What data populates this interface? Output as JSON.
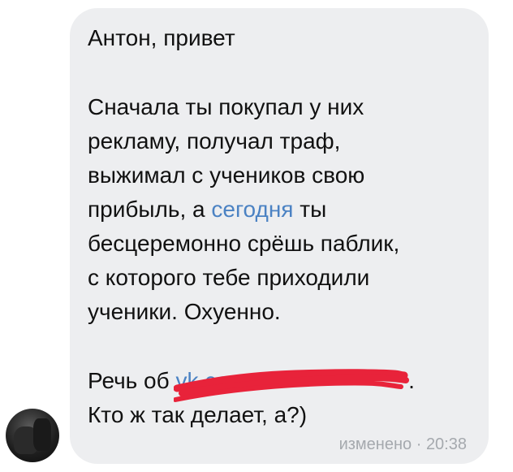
{
  "message": {
    "greeting": "Антон, привет",
    "para1": {
      "line1": "Сначала ты покупал у них",
      "line2": "рекламу, получал траф,",
      "line3": "выжимал с учеников свою",
      "line4_start": "прибыль, а ",
      "line4_link": "сегодня",
      "line4_end": " ты",
      "line5": "бесцеремонно срёшь паблик,",
      "line6": "с которого тебе приходили",
      "line7": "ученики. Охуенно."
    },
    "para2": {
      "line1_start": "Речь об ",
      "line1_link": "vk.com",
      "line1_end": ".",
      "line2": "Кто ж так делает, а?)"
    }
  },
  "meta": {
    "edited_label": "изменено",
    "separator": " · ",
    "time": "20:38"
  },
  "colors": {
    "bubble": "#edeef0",
    "text": "#111111",
    "link": "#4b82c3",
    "meta": "#a5a9ae",
    "redaction": "#e8233a"
  }
}
